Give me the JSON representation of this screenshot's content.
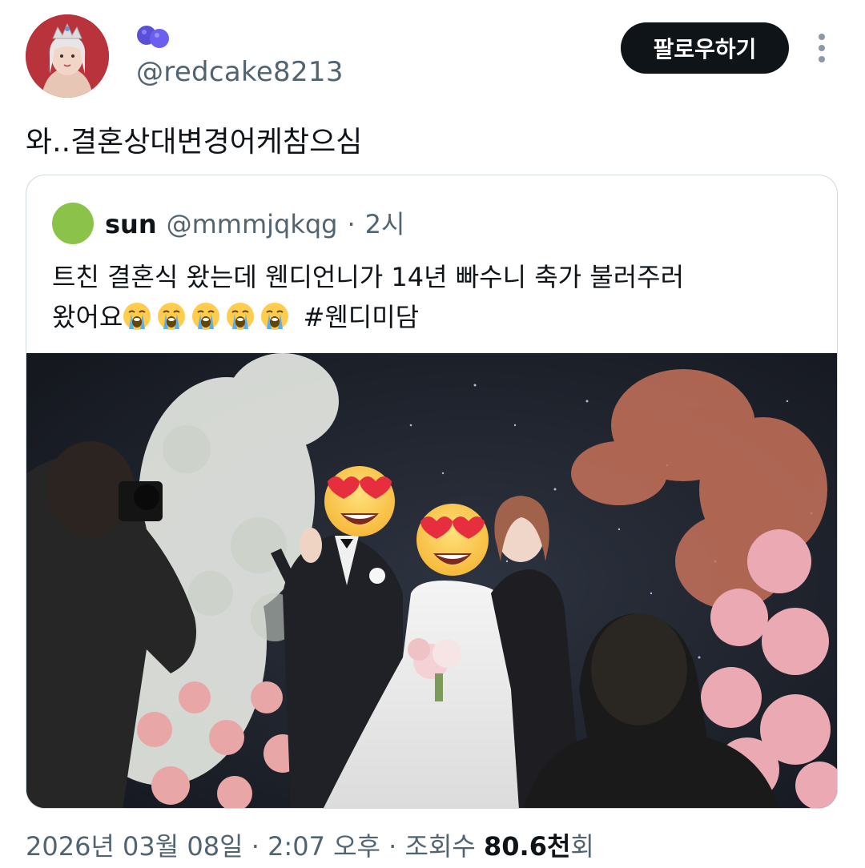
{
  "author": {
    "handle": "@redcake8213",
    "display_name_icon": "blueberry-emoji"
  },
  "follow_button_label": "팔로우하기",
  "more_icon": "vertical-ellipsis-icon",
  "tweet_text": "와..결혼상대변경어케참으심",
  "quoted_tweet": {
    "name": "sun",
    "handle": "@mmmjqkqg",
    "separator": "·",
    "time": "2시",
    "text_line1": "트친 결혼식 왔는데 웬디언니가 14년 빠수니 축가 불러주러",
    "text_line2_prefix": "왔어요",
    "emoji_name": "loudly-crying-face",
    "emoji_count": 5,
    "hashtag": "#웬디미담"
  },
  "meta": {
    "date": "2026년 03월 08일",
    "separator": "·",
    "time": "2:07 오후",
    "views_label": "조회수",
    "views_count": "80.6천",
    "views_unit": "회"
  },
  "colors": {
    "follow_button_bg": "#0f1419",
    "secondary_text": "#536471",
    "border": "#cfd9de",
    "quote_avatar": "#8bc34a"
  }
}
